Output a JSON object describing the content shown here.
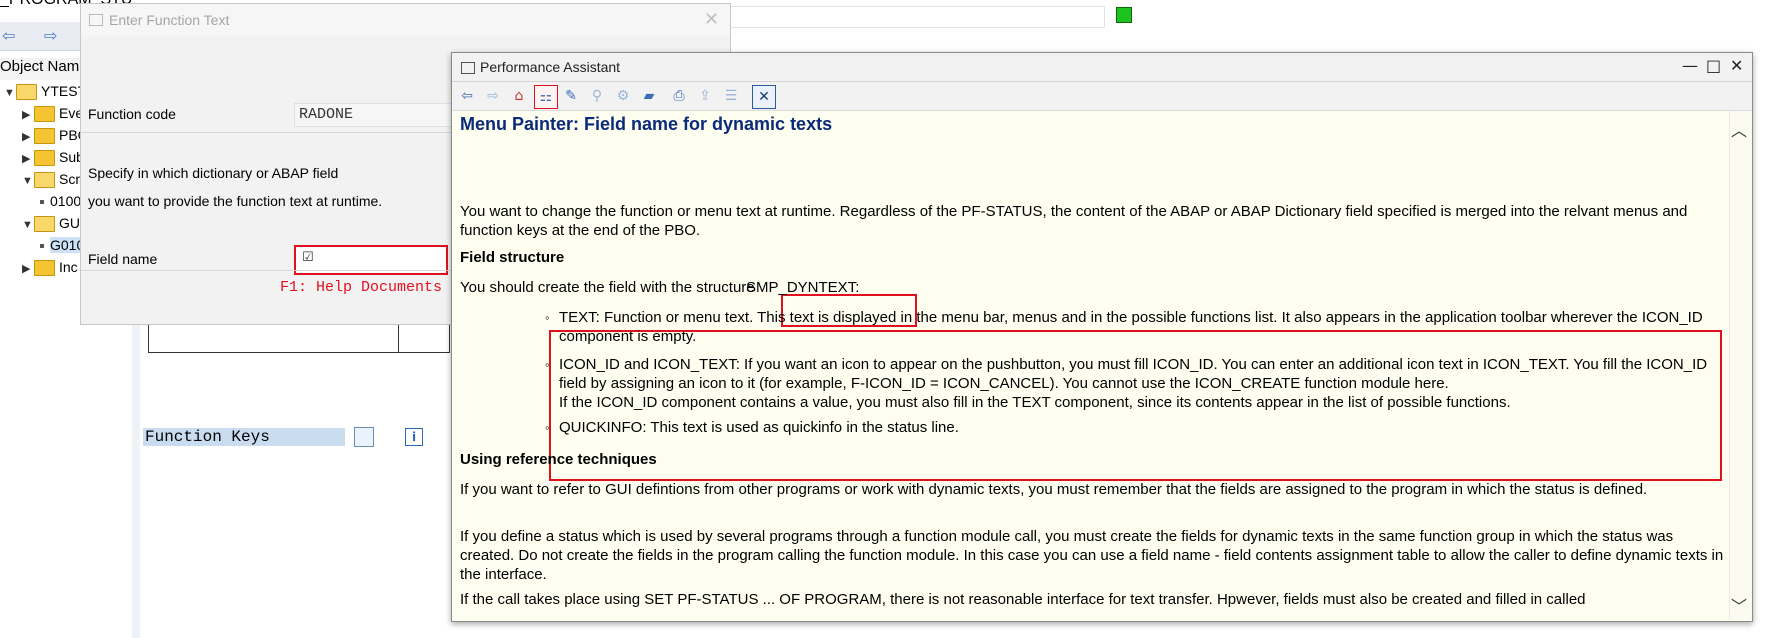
{
  "background": {
    "title": "_PROGRAM_STU",
    "tree_header": "Object Nam",
    "tree": [
      {
        "label": "YTEST",
        "arrow": "▼"
      },
      {
        "label": "Eve",
        "arrow": "▶"
      },
      {
        "label": "PBO",
        "arrow": "▶"
      },
      {
        "label": "Sub",
        "arrow": "▶"
      },
      {
        "label": "Scr",
        "arrow": "▼"
      },
      {
        "label": "0100"
      },
      {
        "label": "GUI",
        "arrow": "▼"
      },
      {
        "label": "G010"
      },
      {
        "label": "Inc",
        "arrow": "▶"
      }
    ],
    "function_keys_label": "Function Keys",
    "info_icon": "i"
  },
  "dialog": {
    "title": "Enter Function Text",
    "close_symbol": "✕",
    "function_code_label": "Function code",
    "function_code_value": "RADONE",
    "desc_line1": "Specify in which dictionary or ABAP field",
    "desc_line2": "you want to provide the function text at runtime.",
    "field_name_label": "Field name",
    "field_name_check": "☑",
    "f1_hint": "F1: Help Documents"
  },
  "assistant": {
    "title": "Performance Assistant",
    "heading": "Menu Painter: Field name for dynamic texts",
    "intro": "You want to change the function or menu text at runtime. Regardless of the PF-STATUS, the content of the ABAP or ABAP Dictionary field specified is merged into the relvant menus and function keys at the end of the PBO.",
    "field_structure_heading": "Field structure",
    "structure_text": "You should create the field with the structure",
    "structure_name": "SMP_DYNTEXT:",
    "items": [
      {
        "text": "TEXT: Function or menu text. This text is displayed in the menu bar, menus and in the possible functions list. It also appears in the application toolbar wherever the ICON_ID component is empty."
      },
      {
        "text": "ICON_ID and ICON_TEXT: If you want an icon to appear on the pushbutton, you must fill ICON_ID. You can enter an additional icon text in ICON_TEXT. You fill the ICON_ID field by assigning an icon to it (for example, F-ICON_ID = ICON_CANCEL). You cannot use the ICON_CREATE function module here.",
        "text2": "If the ICON_ID component contains a value, you must also fill in the TEXT component, since its contents appear in the list of possible functions."
      },
      {
        "text": "QUICKINFO: This text is used as quickinfo in the status line."
      }
    ],
    "ref_heading": "Using reference techniques",
    "ref_p1": "If you want to refer to GUI defintions from other programs or work with dynamic texts, you must remember that the fields are assigned to the program in which the status is defined.",
    "ref_p2": "If you define a status which is used by several programs through a function module call, you must create the fields for dynamic texts in the same function group in which the status was created. Do not create the fields in the program calling the function module. In this case you can use a field name - field contents assignment table to allow the caller to define dynamic texts in the interface.",
    "ref_p3": "If the call takes place using SET PF-STATUS ... OF PROGRAM, there is not reasonable interface for text transfer. Hpwever, fields must also be created and filled in called"
  },
  "icons": {
    "toolbar": [
      "back-icon",
      "forward-icon",
      "home-icon",
      "structure-icon",
      "edit-icon",
      "search-icon",
      "settings-icon",
      "display-icon",
      "print-icon",
      "export-icon",
      "document-icon",
      "close-icon"
    ]
  },
  "colors": {
    "highlight_red": "#e0101e",
    "assistant_bg": "#fefef0",
    "heading_blue": "#0a2a7a",
    "status_green": "#1ec21e"
  }
}
